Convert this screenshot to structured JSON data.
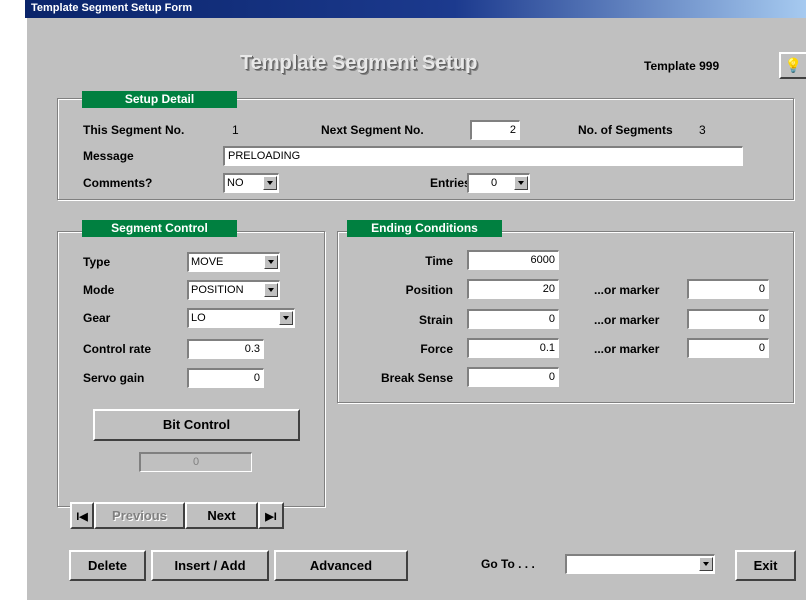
{
  "window": {
    "title": "Template Segment Setup Form"
  },
  "header": {
    "title": "Template Segment Setup",
    "template_label": "Template 999"
  },
  "setup_detail": {
    "title": "Setup Detail",
    "this_segment_label": "This Segment No.",
    "this_segment_value": "1",
    "next_segment_label": "Next Segment No.",
    "next_segment_value": "2",
    "num_segments_label": "No. of Segments",
    "num_segments_value": "3",
    "message_label": "Message",
    "message_value": "PRELOADING",
    "comments_label": "Comments?",
    "comments_value": "NO",
    "entries_label": "Entries",
    "entries_value": "0"
  },
  "segment_control": {
    "title": "Segment Control",
    "type_label": "Type",
    "type_value": "MOVE",
    "mode_label": "Mode",
    "mode_value": "POSITION",
    "gear_label": "Gear",
    "gear_value": "LO",
    "control_rate_label": "Control rate",
    "control_rate_value": "0.3",
    "servo_gain_label": "Servo gain",
    "servo_gain_value": "0",
    "bit_control_label": "Bit Control",
    "bit_control_value": "0"
  },
  "ending_conditions": {
    "title": "Ending Conditions",
    "time_label": "Time",
    "time_value": "6000",
    "position_label": "Position",
    "position_value": "20",
    "strain_label": "Strain",
    "strain_value": "0",
    "force_label": "Force",
    "force_value": "0.1",
    "break_sense_label": "Break Sense",
    "break_sense_value": "0",
    "or_marker_label": "...or marker",
    "position_marker": "0",
    "strain_marker": "0",
    "force_marker": "0"
  },
  "nav": {
    "first": "I◀",
    "previous": "Previous",
    "next": "Next",
    "last": "▶I"
  },
  "footer": {
    "delete": "Delete",
    "insert_add": "Insert / Add",
    "advanced": "Advanced",
    "goto_label": "Go To . . .",
    "goto_value": "",
    "exit": "Exit"
  }
}
